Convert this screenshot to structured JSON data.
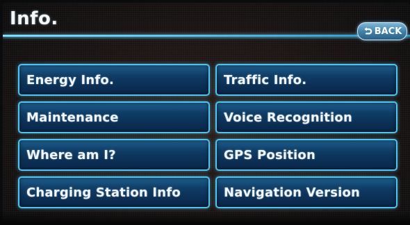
{
  "header": {
    "title": "Info.",
    "back_label": "BACK"
  },
  "menu": {
    "items": [
      {
        "label": "Energy Info."
      },
      {
        "label": "Traffic Info."
      },
      {
        "label": "Maintenance"
      },
      {
        "label": "Voice Recognition"
      },
      {
        "label": "Where am I?"
      },
      {
        "label": "GPS Position"
      },
      {
        "label": "Charging Station Info"
      },
      {
        "label": "Navigation Version"
      }
    ]
  },
  "colors": {
    "button_border": "#4fc4ee",
    "button_fill": "#0f3d66",
    "header_line": "#7fe0ff",
    "back_button": "#3f7fa8"
  }
}
